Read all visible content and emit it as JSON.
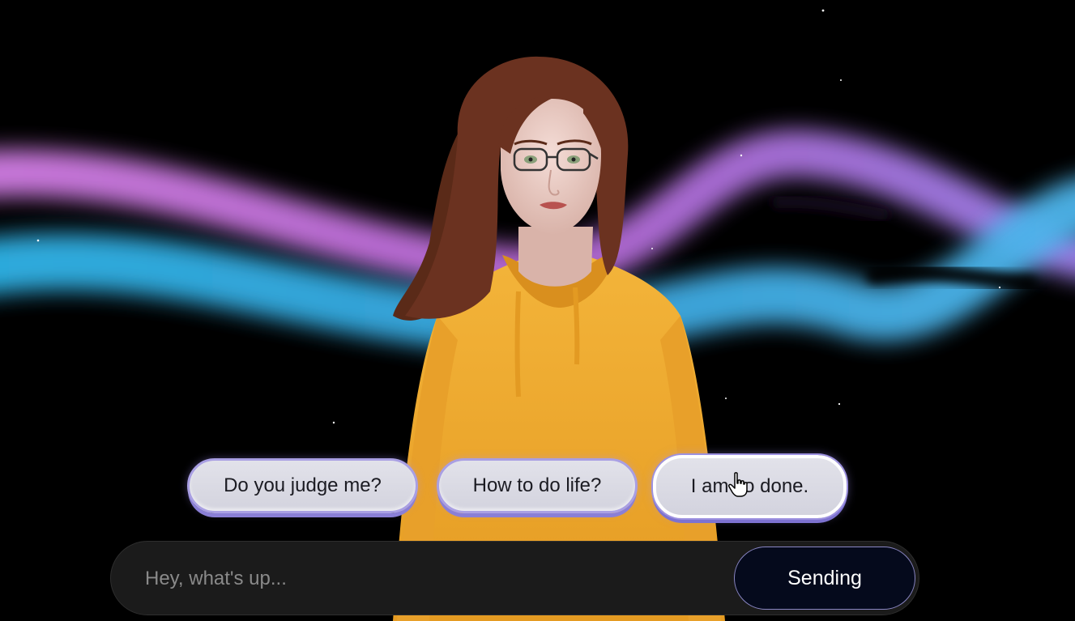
{
  "suggestions": [
    {
      "label": "Do you judge me?"
    },
    {
      "label": "How to do life?"
    },
    {
      "label": "I am so done."
    }
  ],
  "chat_input": {
    "placeholder": "Hey, what's up...",
    "value": ""
  },
  "send_button": {
    "label": "Sending"
  },
  "colors": {
    "aurora_pink": "#c77be0",
    "aurora_blue": "#3fb2e6",
    "hoodie": "#f0a92e",
    "chip_fill": "#dadae3",
    "chip_border": "#a99fe3",
    "send_bg": "#050a1c"
  },
  "icons": {
    "cursor": "hand-pointer-icon"
  }
}
